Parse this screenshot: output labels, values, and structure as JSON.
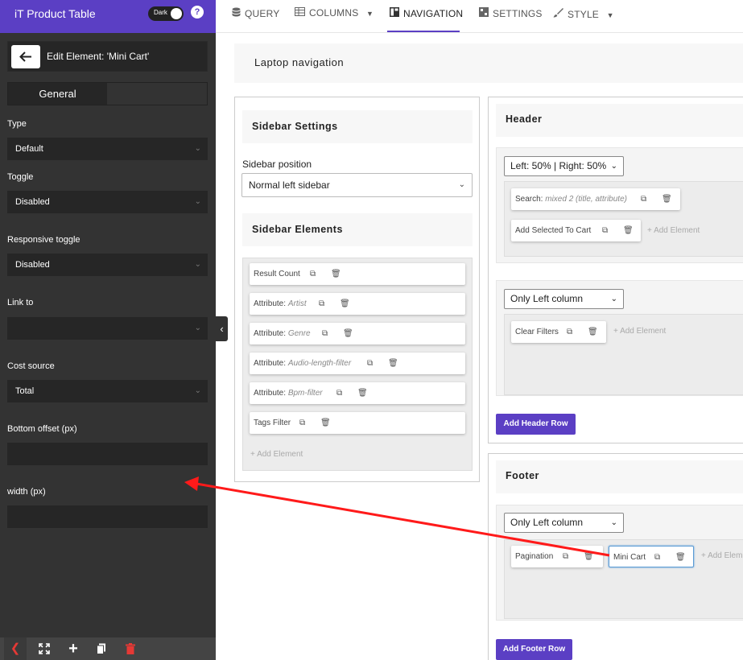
{
  "app": {
    "title": "iT Product Table",
    "dark_label": "Dark",
    "help": "?"
  },
  "editor": {
    "title": "Edit Element: 'Mini Cart'",
    "tab_general": "General",
    "fields": {
      "type_label": "Type",
      "type_value": "Default",
      "toggle_label": "Toggle",
      "toggle_value": "Disabled",
      "responsive_label": "Responsive toggle",
      "responsive_value": "Disabled",
      "link_label": "Link to",
      "link_value": "",
      "cost_label": "Cost source",
      "cost_value": "Total",
      "bottom_label": "Bottom offset (px)",
      "width_label": "width (px)"
    }
  },
  "topnav": {
    "query": "QUERY",
    "columns": "COLUMNS",
    "navigation": "NAVIGATION",
    "settings": "SETTINGS",
    "style": "STYLE",
    "active": "NAVIGATION"
  },
  "main": {
    "laptop_title": "Laptop navigation",
    "sidebar": {
      "settings_title": "Sidebar Settings",
      "position_label": "Sidebar position",
      "position_value": "Normal left sidebar",
      "elements_title": "Sidebar Elements",
      "elements": [
        {
          "label": "Result Count",
          "detail": ""
        },
        {
          "label": "Attribute: ",
          "detail": "Artist"
        },
        {
          "label": "Attribute: ",
          "detail": "Genre"
        },
        {
          "label": "Attribute: ",
          "detail": "Audio-length-filter"
        },
        {
          "label": "Attribute: ",
          "detail": "Bpm-filter"
        },
        {
          "label": "Tags Filter",
          "detail": ""
        }
      ],
      "add_element": "+ Add Element"
    },
    "header": {
      "title": "Header",
      "row1_layout": "Left: 50% | Right: 50%",
      "row1_elements": [
        {
          "label": "Search: ",
          "detail": "mixed 2 (title, attribute)"
        },
        {
          "label": "Add Selected To Cart",
          "detail": ""
        }
      ],
      "row1_add": "+ Add Element",
      "row2_layout": "Only Left column",
      "row2_elements": [
        {
          "label": "Clear Filters",
          "detail": ""
        }
      ],
      "row2_add": "+ Add Element",
      "add_row": "Add Header Row"
    },
    "footer": {
      "title": "Footer",
      "row_layout": "Only Left column",
      "elements": [
        {
          "label": "Pagination",
          "detail": ""
        },
        {
          "label": "Mini Cart",
          "detail": ""
        }
      ],
      "add": "+ Add Elem",
      "add_row": "Add Footer Row"
    }
  },
  "colors": {
    "accent": "#5b3fc4",
    "panel": "#333333",
    "arrow": "#ff0000"
  }
}
